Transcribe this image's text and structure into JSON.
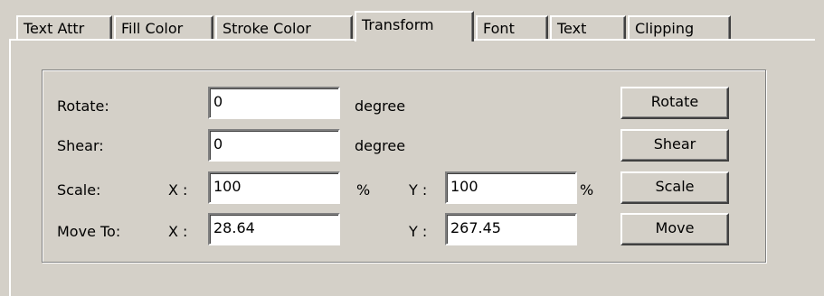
{
  "tabs": [
    {
      "label": "Text Attr"
    },
    {
      "label": "Fill Color"
    },
    {
      "label": "Stroke Color"
    },
    {
      "label": "Transform"
    },
    {
      "label": "Font"
    },
    {
      "label": "Text"
    },
    {
      "label": "Clipping"
    }
  ],
  "active_tab": "Transform",
  "transform": {
    "rotate": {
      "label": "Rotate:",
      "value": "0",
      "unit": "degree",
      "button": "Rotate"
    },
    "shear": {
      "label": "Shear:",
      "value": "0",
      "unit": "degree",
      "button": "Shear"
    },
    "scale": {
      "label": "Scale:",
      "x_label": "X :",
      "x_value": "100",
      "x_unit": "%",
      "y_label": "Y :",
      "y_value": "100",
      "y_unit": "%",
      "button": "Scale"
    },
    "move": {
      "label": "Move To:",
      "x_label": "X :",
      "x_value": "28.64",
      "y_label": "Y :",
      "y_value": "267.45",
      "button": "Move"
    }
  }
}
